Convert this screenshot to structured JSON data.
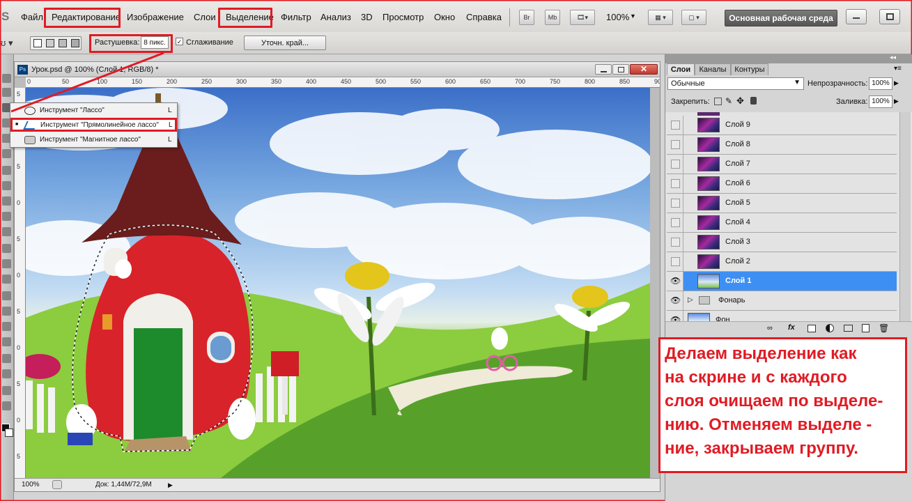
{
  "menu": {
    "logo": "S",
    "items": [
      "Файл",
      "Редактирование",
      "Изображение",
      "Слои",
      "Выделение",
      "Фильтр",
      "Анализ",
      "3D",
      "Просмотр",
      "Окно",
      "Справка"
    ],
    "bridge_label": "Br",
    "minibridge_label": "Mb",
    "zoom_value": "100%",
    "workspace": "Основная рабочая среда"
  },
  "options_bar": {
    "feather_label": "Растушевка:",
    "feather_value": "8 пикс.",
    "antialias_label": "Сглаживание",
    "refine_edge": "Уточн. край..."
  },
  "document": {
    "title": "Урок.psd @ 100% (Слой 1, RGB/8) *",
    "ps_badge": "Ps",
    "ruler_ticks": [
      "100",
      "50",
      "0",
      "50",
      "100",
      "150",
      "200",
      "250",
      "300",
      "350",
      "400",
      "450",
      "500",
      "550",
      "600",
      "650",
      "700",
      "750",
      "800",
      "850",
      "900"
    ],
    "vruler_ticks": [
      "5",
      "0",
      "5",
      "0",
      "5",
      "0",
      "5",
      "0",
      "5",
      "0",
      "5"
    ],
    "status_zoom": "100%",
    "status_doc": "Док: 1,44M/72,9M"
  },
  "lasso_menu": {
    "items": [
      {
        "label": "Инструмент \"Лассо\"",
        "shortcut": "L"
      },
      {
        "label": "Инструмент \"Прямолинейное лассо\"",
        "shortcut": "L"
      },
      {
        "label": "Инструмент \"Магнитное лассо\"",
        "shortcut": "L"
      }
    ],
    "selected_marker": "■"
  },
  "layers_panel": {
    "tabs": [
      "Слои",
      "Каналы",
      "Контуры"
    ],
    "blend_mode": "Обычные",
    "opacity_label": "Непрозрачность:",
    "opacity_value": "100%",
    "lock_label": "Закрепить:",
    "fill_label": "Заливка:",
    "fill_value": "100%",
    "layers": [
      {
        "name": "Слой 9"
      },
      {
        "name": "Слой 8"
      },
      {
        "name": "Слой 7"
      },
      {
        "name": "Слой 6"
      },
      {
        "name": "Слой 5"
      },
      {
        "name": "Слой 4"
      },
      {
        "name": "Слой 3"
      },
      {
        "name": "Слой 2"
      },
      {
        "name": "Слой 1"
      }
    ],
    "group_name": "Фонарь",
    "background_name": "Фон",
    "footer_fx": "fx"
  },
  "annotation": {
    "text": "Делаем выделение как\nна скрине и с каждого\nслоя очищаем по выделе-\nнию. Отменяем выделе -\nние, закрываем группу."
  },
  "colors": {
    "highlight": "#e01b24",
    "selected_layer": "#3e8ff3"
  }
}
